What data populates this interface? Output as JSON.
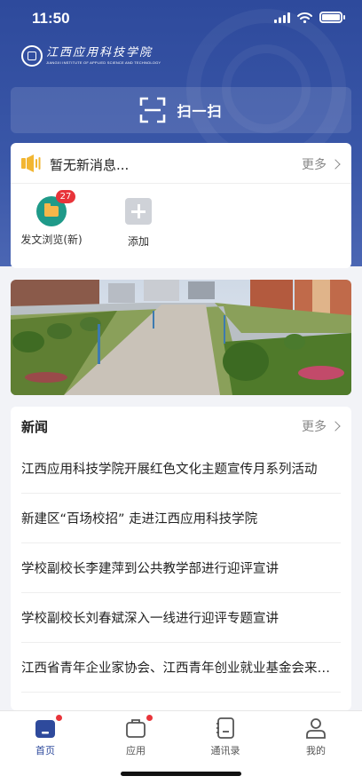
{
  "status_bar": {
    "time": "11:50"
  },
  "header": {
    "logo_cn": "江西应用科技学院",
    "logo_en": "JIANGXI INSTITUTE OF APPLIED SCIENCE AND TECHNOLOGY",
    "scan_label": "扫一扫"
  },
  "notice": {
    "text": "暂无新消息...",
    "more_label": "更多"
  },
  "apps": [
    {
      "label": "发文浏览(新)",
      "icon": "folder-icon",
      "badge": "27"
    },
    {
      "label": "添加",
      "icon": "add-icon"
    }
  ],
  "news": {
    "title": "新闻",
    "more_label": "更多",
    "items": [
      "江西应用科技学院开展红色文化主题宣传月系列活动",
      "新建区“百场校招” 走进江西应用科技学院",
      "学校副校长李建萍到公共教学部进行迎评宣讲",
      "学校副校长刘春斌深入一线进行迎评专题宣讲",
      "江西省青年企业家协会、江西青年创业就业基金会来校调研"
    ]
  },
  "tabbar": [
    {
      "label": "首页",
      "icon": "home-icon",
      "active": true,
      "dot": true
    },
    {
      "label": "应用",
      "icon": "briefcase-icon",
      "dot": true
    },
    {
      "label": "通讯录",
      "icon": "contacts-icon"
    },
    {
      "label": "我的",
      "icon": "person-icon"
    }
  ],
  "colors": {
    "primary": "#2e4a9c",
    "badge": "#e8343a",
    "folder_bg": "#1f9a89",
    "speaker": "#f2b632"
  }
}
